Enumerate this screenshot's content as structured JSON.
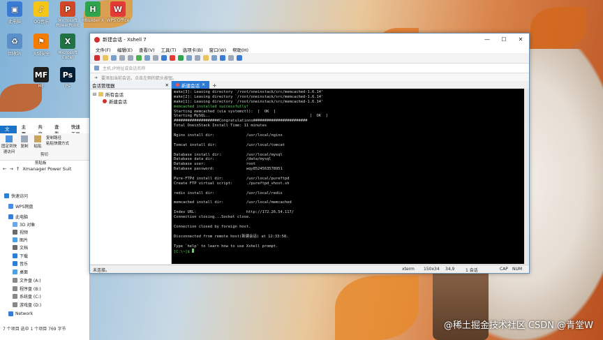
{
  "desktop": {
    "icons": [
      {
        "label": "此电脑",
        "color": "#3a7bd5",
        "glyph": "▣"
      },
      {
        "label": "QQ音乐",
        "color": "#f5c518",
        "glyph": "♪"
      },
      {
        "label": "Microsoft PowerPoint",
        "color": "#d24726",
        "glyph": "P"
      },
      {
        "label": "HBuilder X",
        "color": "#2ea44f",
        "glyph": "H"
      },
      {
        "label": "WPS Office",
        "color": "#e53935",
        "glyph": "W"
      },
      {
        "label": "回收站",
        "color": "#5b8fc7",
        "glyph": "♻"
      },
      {
        "label": "火绒安全",
        "color": "#f57c00",
        "glyph": "⚑"
      },
      {
        "label": "Microsoft Excel",
        "color": "#217346",
        "glyph": "X"
      },
      {
        "label": "MF",
        "color": "#1e1e1e",
        "glyph": "MF"
      },
      {
        "label": "Ps",
        "color": "#001e36",
        "glyph": "Ps"
      }
    ],
    "watermark": "@稀土掘金技术社区  CSDN @青堂W"
  },
  "explorer": {
    "tabs": [
      "文件",
      "主页",
      "共享",
      "查看"
    ],
    "tab_extra": "快速工具",
    "ribbon": [
      "固定到快速访问",
      "复制",
      "粘贴",
      "复制路径",
      "粘贴快捷方式",
      "剪切"
    ],
    "ribbon_group": "剪贴板",
    "address": "Xmanager Power Suit",
    "nav": [
      {
        "label": "快速访问",
        "color": "#2f7fd6"
      },
      {
        "label": "WPS网盘",
        "color": "#4b8be6"
      },
      {
        "label": "此电脑",
        "color": "#3a7bd5"
      },
      {
        "label": "3D 对象",
        "color": "#6aa8e8"
      },
      {
        "label": "视频",
        "color": "#6a6a6a"
      },
      {
        "label": "图片",
        "color": "#4fa0e0"
      },
      {
        "label": "文档",
        "color": "#6a6a6a"
      },
      {
        "label": "下载",
        "color": "#2f7fd6"
      },
      {
        "label": "音乐",
        "color": "#2f7fd6"
      },
      {
        "label": "桌面",
        "color": "#4fa0e0"
      },
      {
        "label": "文件盘 (A:)",
        "color": "#888"
      },
      {
        "label": "程序盘 (B:)",
        "color": "#888"
      },
      {
        "label": "系统盘 (C:)",
        "color": "#888"
      },
      {
        "label": "游戏盘 (D:)",
        "color": "#888"
      },
      {
        "label": "Network",
        "color": "#3a7bd5"
      }
    ],
    "status": "7 个项目    选中 1 个项目  769 字节"
  },
  "xshell": {
    "title": "新建会话 - Xshell 7",
    "menu": [
      "文件(F)",
      "编辑(E)",
      "查看(V)",
      "工具(T)",
      "选项卡(B)",
      "窗口(W)",
      "帮助(H)"
    ],
    "address_placeholder": "主机,IP地址或会话名称",
    "hint": "要添加当前会话，点击左侧的箭头按钮。",
    "session_panel_title": "会话管理器",
    "session_tree": [
      "所有会话",
      "新建会话"
    ],
    "tab_label": "新建会话",
    "terminal_lines": [
      {
        "t": "make[3]: Leaving directory `/root/oneinstack/src/memcached-1.6.14'",
        "c": ""
      },
      {
        "t": "make[2]: Leaving directory `/root/oneinstack/src/memcached-1.6.14'",
        "c": ""
      },
      {
        "t": "make[1]: Leaving directory `/root/oneinstack/src/memcached-1.6.14'",
        "c": ""
      },
      {
        "t": "memcached installed successfully!",
        "c": "green"
      },
      {
        "t": "Starting memcached (via systemctl):  [  OK  ]",
        "c": ""
      },
      {
        "t": "Starting MySQL..                                            [  OK  ]",
        "c": ""
      },
      {
        "t": "####################Congratulations########################",
        "c": ""
      },
      {
        "t": "Total OneinStack Install Time: 11 minutes",
        "c": ""
      },
      {
        "t": "",
        "c": ""
      },
      {
        "t": "Nginx install dir:              /usr/local/nginx",
        "c": ""
      },
      {
        "t": "",
        "c": ""
      },
      {
        "t": "Tomcat install dir:             /usr/local/tomcat",
        "c": ""
      },
      {
        "t": "",
        "c": ""
      },
      {
        "t": "Database install dir:           /usr/local/mysql",
        "c": ""
      },
      {
        "t": "Database data dir:              /data/mysql",
        "c": ""
      },
      {
        "t": "Database user:                  root",
        "c": ""
      },
      {
        "t": "Database password:              wqy8524563578951",
        "c": ""
      },
      {
        "t": "",
        "c": ""
      },
      {
        "t": "Pure-FTPd install dir:          /usr/local/pureftpd",
        "c": ""
      },
      {
        "t": "Create FTP virtual script:      ./pureftpd_vhost.sh",
        "c": ""
      },
      {
        "t": "",
        "c": ""
      },
      {
        "t": "redis install dir:              /usr/local/redis",
        "c": ""
      },
      {
        "t": "",
        "c": ""
      },
      {
        "t": "memcached install dir:          /usr/local/memcached",
        "c": ""
      },
      {
        "t": "",
        "c": ""
      },
      {
        "t": "Index URL:                      http://172.26.54.117/",
        "c": ""
      },
      {
        "t": "Connection closing...Socket close.",
        "c": ""
      },
      {
        "t": "",
        "c": ""
      },
      {
        "t": "Connection closed by foreign host.",
        "c": ""
      },
      {
        "t": "",
        "c": ""
      },
      {
        "t": "Disconnected from remote host(新建会话) at 12:33:58.",
        "c": ""
      },
      {
        "t": "",
        "c": ""
      },
      {
        "t": "Type `help' to learn how to use Xshell prompt.",
        "c": ""
      },
      {
        "t": "[C:\\~]$ ",
        "c": "green"
      }
    ],
    "status": {
      "left": "未连接。",
      "term": "xterm",
      "size": "150x34",
      "pos": "34,9",
      "sessions": "1 会话",
      "cap": "CAP",
      "num": "NUM"
    }
  }
}
